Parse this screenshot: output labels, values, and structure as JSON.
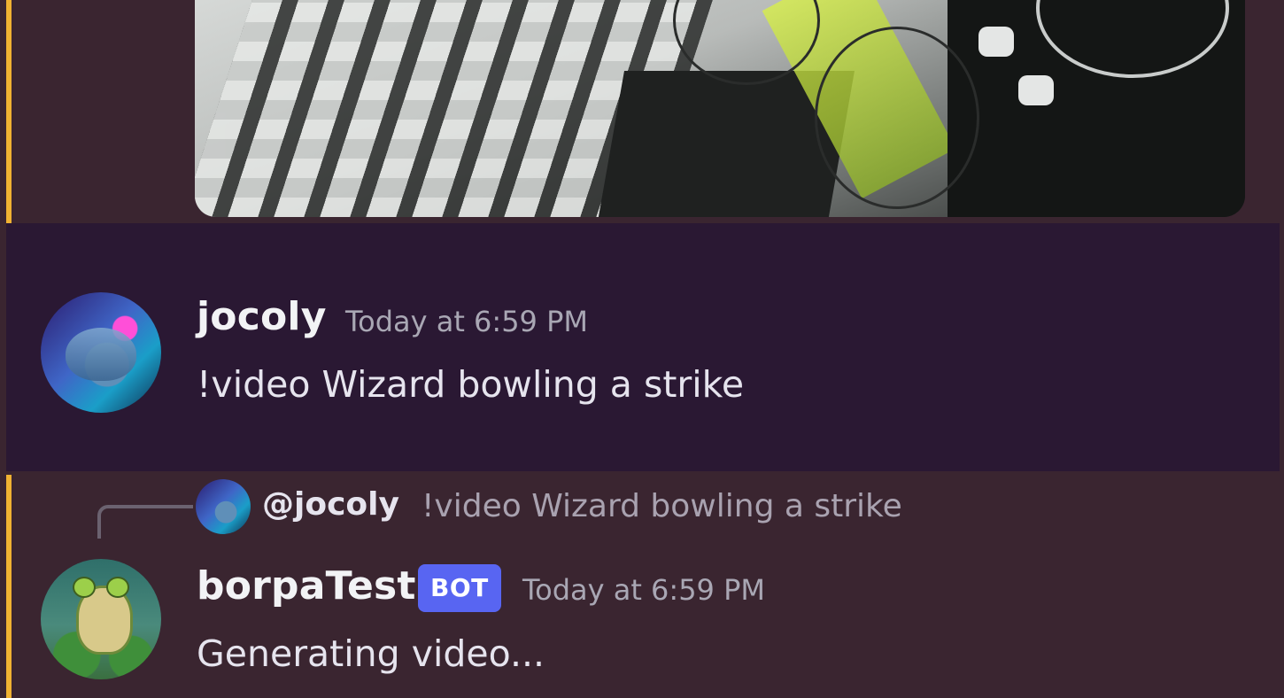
{
  "messages": {
    "user": {
      "username": "jocoly",
      "timestamp": "Today at 6:59 PM",
      "text": "!video Wizard bowling a strike",
      "avatar_icon": "cat-avatar-icon"
    },
    "reply_preview": {
      "mention": "@jocoly",
      "text": "!video Wizard bowling a strike",
      "avatar_icon": "cat-avatar-icon"
    },
    "bot": {
      "username": "borpaTest",
      "badge": "BOT",
      "timestamp": "Today at 6:59 PM",
      "text": "Generating video...",
      "avatar_icon": "frog-avatar-icon"
    }
  },
  "colors": {
    "chat_background": "#3a2530",
    "highlight_background": "#2a1833",
    "mention_bar": "#f0b232",
    "bot_badge": "#5865f2",
    "username": "#f2f3f5",
    "timestamp": "#a9a7b4"
  }
}
